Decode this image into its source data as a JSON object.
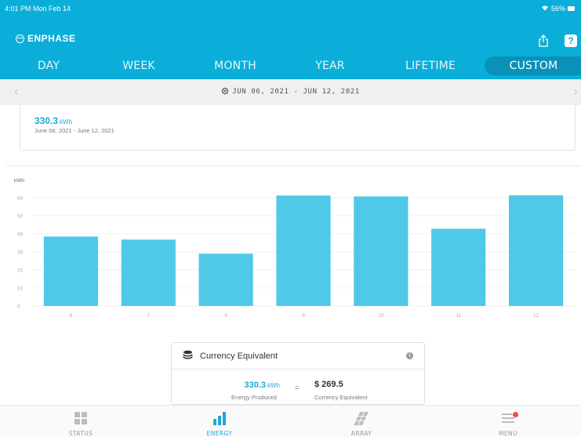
{
  "status_bar": {
    "time": "4:01 PM  Mon Feb 14",
    "battery": "56%"
  },
  "brand": {
    "name": "ENPHASE"
  },
  "tabs": [
    {
      "label": "DAY",
      "active": false
    },
    {
      "label": "WEEK",
      "active": false
    },
    {
      "label": "MONTH",
      "active": false
    },
    {
      "label": "YEAR",
      "active": false
    },
    {
      "label": "LIFETIME",
      "active": false
    },
    {
      "label": "CUSTOM",
      "active": true
    }
  ],
  "date_bar": {
    "range": "JUN 06, 2021 - JUN 12, 2021"
  },
  "summary": {
    "value": "330.3",
    "unit": "kWh",
    "dates": "June 06, 2021 - June 12, 2021"
  },
  "chart_data": {
    "type": "bar",
    "ylabel": "kWh",
    "categories": [
      "6",
      "7",
      "8",
      "9",
      "10",
      "11",
      "12"
    ],
    "values": [
      38.5,
      36.8,
      29,
      61.2,
      60.7,
      42.8,
      61.3
    ],
    "ylim": [
      0,
      60
    ],
    "yticks": [
      "0",
      "10",
      "20",
      "30",
      "40",
      "50",
      "60"
    ],
    "color": "#4fc9e8",
    "grid": true
  },
  "currency": {
    "title": "Currency Equivalent",
    "energy_value": "330.3",
    "energy_unit": "kWh",
    "energy_label": "Energy Produced",
    "equals": "=",
    "currency_value": "$ 269.5",
    "currency_label": "Currency Equivalent"
  },
  "bottom_nav": [
    {
      "label": "STATUS",
      "icon": "grid-icon",
      "active": false
    },
    {
      "label": "ENERGY",
      "icon": "bar-chart-icon",
      "active": true
    },
    {
      "label": "ARRAY",
      "icon": "solar-array-icon",
      "active": false
    },
    {
      "label": "MENU",
      "icon": "menu-icon",
      "active": false
    }
  ],
  "colors": {
    "header": "#0aaed9",
    "accent": "#1aa9da",
    "bar": "#4fc9e8",
    "notification": "#ef4b4b"
  }
}
